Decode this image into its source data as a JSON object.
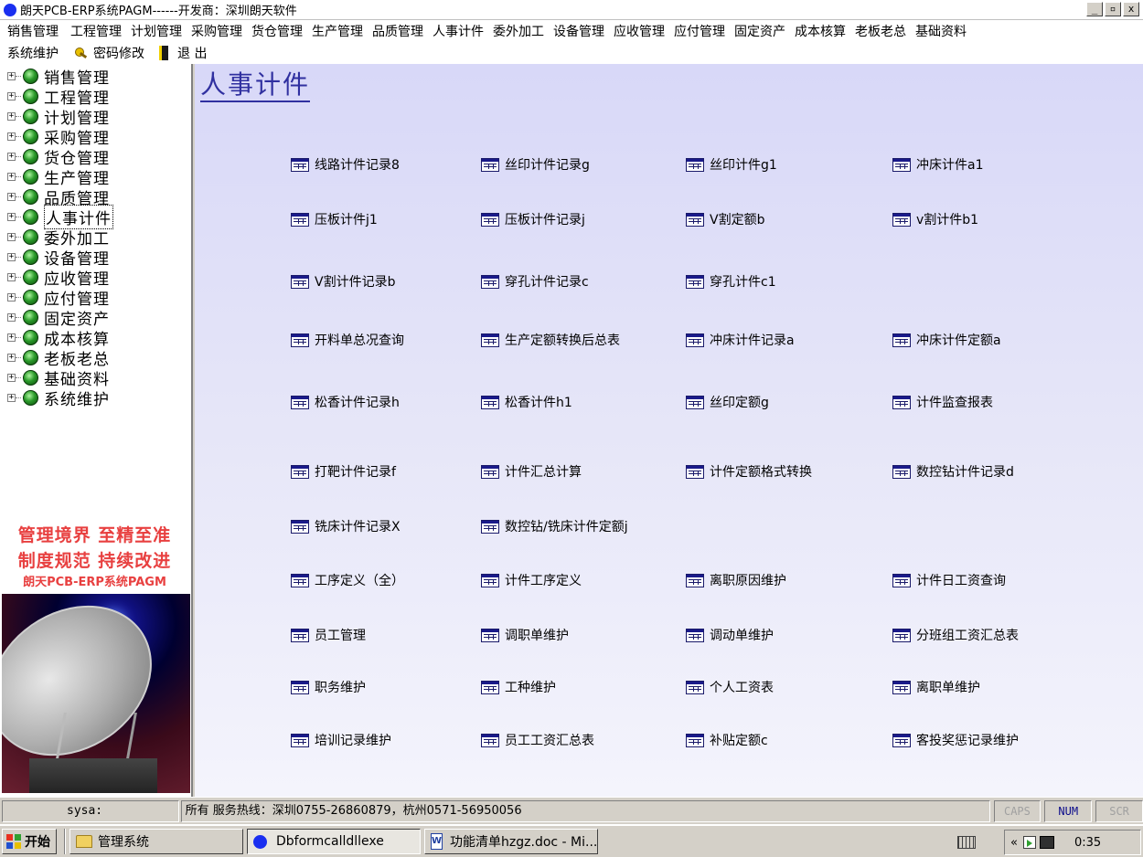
{
  "window": {
    "title": "朗天PCB-ERP系统PAGM------开发商：深圳朗天软件",
    "minimize": "_",
    "maximize": "▫",
    "close": "x"
  },
  "menu": {
    "row1": [
      "销售管理",
      "工程管理",
      "计划管理",
      "采购管理",
      "货仓管理",
      "生产管理",
      "品质管理",
      "人事计件",
      "委外加工",
      "设备管理",
      "应收管理",
      "应付管理",
      "固定资产",
      "成本核算",
      "老板老总",
      "基础资料"
    ],
    "system": "系统维护",
    "password": "密码修改",
    "exit": "退 出"
  },
  "tree": {
    "items": [
      "销售管理",
      "工程管理",
      "计划管理",
      "采购管理",
      "货仓管理",
      "生产管理",
      "品质管理",
      "人事计件",
      "委外加工",
      "设备管理",
      "应收管理",
      "应付管理",
      "固定资产",
      "成本核算",
      "老板老总",
      "基础资料",
      "系统维护"
    ],
    "selected_index": 7
  },
  "slogan": {
    "line1": "管理境界 至精至准",
    "line2": "制度规范 持续改进",
    "line3": "朗天PCB-ERP系统PAGM"
  },
  "content": {
    "title": "人事计件",
    "functions": [
      "线路计件记录8",
      "丝印计件记录g",
      "丝印计件g1",
      "冲床计件a1",
      "压板计件j1",
      "压板计件记录j",
      "V割定额b",
      "v割计件b1",
      "V割计件记录b",
      "穿孔计件记录c",
      "穿孔计件c1",
      "开料单总况查询",
      "生产定额转换后总表",
      "冲床计件记录a",
      "冲床计件定额a",
      "松香计件记录h",
      "松香计件h1",
      "丝印定额g",
      "计件监查报表",
      "打靶计件记录f",
      "计件汇总计算",
      "计件定额格式转换",
      "数控钻计件记录d",
      "铣床计件记录X",
      "数控钻/铣床计件定额j",
      "工序定义（全）",
      "计件工序定义",
      "离职原因维护",
      "计件日工资查询",
      "员工管理",
      "调职单维护",
      "调动单维护",
      "分班组工资汇总表",
      "职务维护",
      "工种维护",
      "个人工资表",
      "离职单维护",
      "培训记录维护",
      "员工工资汇总表",
      "补贴定额c",
      "客投奖惩记录维护"
    ]
  },
  "status": {
    "user": "sysa:",
    "message": "所有  服务热线：深圳0755-26860879，杭州0571-56950056",
    "caps": "CAPS",
    "num": "NUM",
    "scr": "SCR"
  },
  "taskbar": {
    "start": "开始",
    "tasks": [
      "管理系统",
      "Dbformcalldllexe",
      "功能清单hzgz.doc - Mi..."
    ],
    "tray_arrow": "«",
    "time": "0:35"
  }
}
